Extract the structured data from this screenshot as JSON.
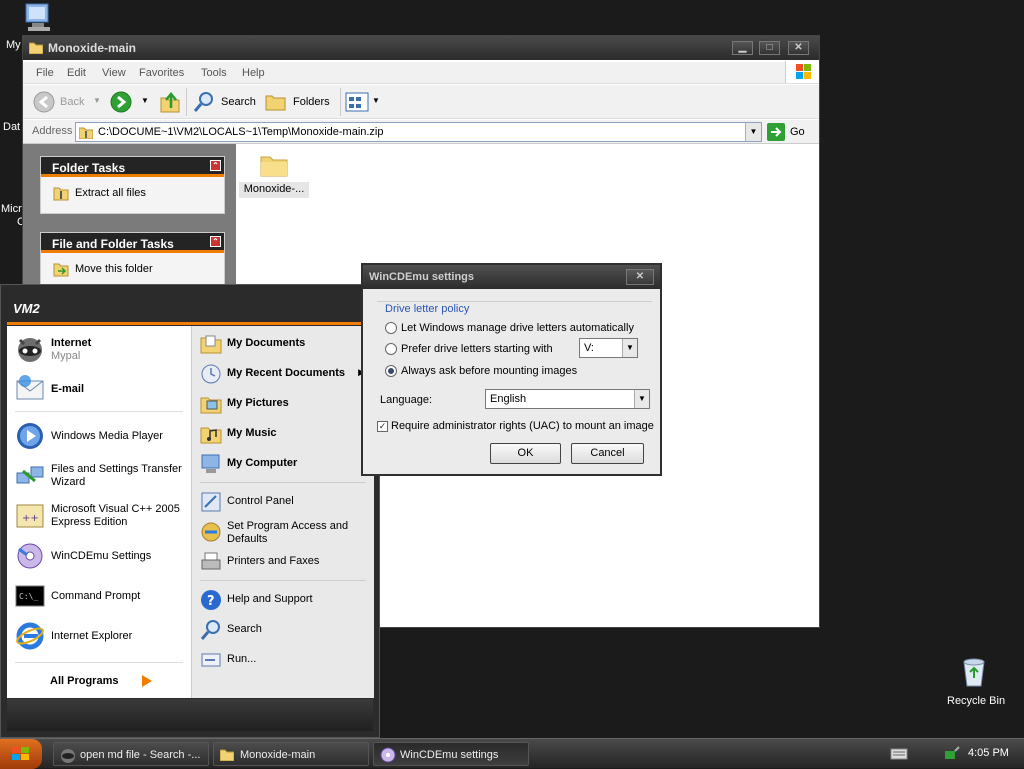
{
  "desktop": {
    "icons": [
      {
        "label": "My"
      },
      {
        "label": "Dat"
      },
      {
        "label": "Micro"
      },
      {
        "label": "C"
      },
      {
        "label": "Recycle Bin"
      }
    ]
  },
  "explorer": {
    "title": "Monoxide-main",
    "menu": [
      "File",
      "Edit",
      "View",
      "Favorites",
      "Tools",
      "Help"
    ],
    "toolbar": {
      "back": "Back",
      "search": "Search",
      "folders": "Folders"
    },
    "address_label": "Address",
    "address_value": "C:\\DOCUME~1\\VM2\\LOCALS~1\\Temp\\Monoxide-main.zip",
    "go_label": "Go",
    "folder_tasks": {
      "title": "Folder Tasks",
      "items": [
        "Extract all files"
      ]
    },
    "file_folder_tasks": {
      "title": "File and Folder Tasks",
      "items": [
        "Move this folder"
      ]
    },
    "files": [
      {
        "name": "Monoxide-..."
      }
    ]
  },
  "start_menu": {
    "user": "VM2",
    "pinned": [
      {
        "title": "Internet",
        "subtitle": "Mypal",
        "icon": "raccoon-browser-icon"
      },
      {
        "title": "E-mail",
        "icon": "email-icon"
      }
    ],
    "recent": [
      {
        "label": "Windows Media Player",
        "icon": "media-player-icon"
      },
      {
        "label": "Files and Settings Transfer Wizard",
        "icon": "transfer-wizard-icon"
      },
      {
        "label": "Microsoft Visual C++ 2005 Express Edition",
        "icon": "visual-cpp-icon"
      },
      {
        "label": "WinCDEmu Settings",
        "icon": "wincdemu-icon"
      },
      {
        "label": "Command Prompt",
        "icon": "cmd-icon"
      },
      {
        "label": "Internet Explorer",
        "icon": "ie-icon"
      }
    ],
    "all_programs": "All Programs",
    "right": [
      {
        "label": "My Documents",
        "bold": true
      },
      {
        "label": "My Recent Documents",
        "bold": true
      },
      {
        "label": "My Pictures",
        "bold": true
      },
      {
        "label": "My Music",
        "bold": true
      },
      {
        "label": "My Computer",
        "bold": true
      },
      {
        "label": "Control Panel",
        "bold": false
      },
      {
        "label": "Set Program Access and Defaults",
        "bold": false
      },
      {
        "label": "Printers and Faxes",
        "bold": false
      },
      {
        "label": "Help and Support",
        "bold": false
      },
      {
        "label": "Search",
        "bold": false
      },
      {
        "label": "Run...",
        "bold": false
      }
    ]
  },
  "dialog": {
    "title": "WinCDEmu settings",
    "group_label": "Drive letter policy",
    "options": [
      "Let Windows manage drive letters automatically",
      "Prefer drive letters starting with",
      "Always ask before mounting images"
    ],
    "selected_option": 2,
    "drive_letter": "V:",
    "language_label": "Language:",
    "language_value": "English",
    "uac_label": "Require administrator rights (UAC) to mount an image",
    "uac_checked": true,
    "ok": "OK",
    "cancel": "Cancel"
  },
  "taskbar": {
    "buttons": [
      {
        "label": "open md file - Search -..."
      },
      {
        "label": "Monoxide-main"
      },
      {
        "label": "WinCDEmu settings"
      }
    ],
    "clock": "4:05 PM"
  },
  "colors": {
    "accent_orange": "#f07c00",
    "task_header": "#242424",
    "link_blue": "#2a56b0"
  }
}
